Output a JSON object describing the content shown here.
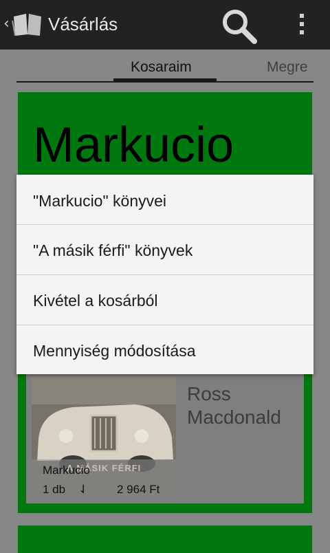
{
  "actionbar": {
    "title": "Vásárlás",
    "up_icon": "chevron-left-icon",
    "logo_icon": "open-book-icon",
    "search_icon": "search-icon",
    "overflow_icon": "more-vertical-icon"
  },
  "tabs": [
    {
      "label": "Kosaraim",
      "active": true
    },
    {
      "label": "Megre",
      "active": false
    }
  ],
  "cart": {
    "title": "Markucio",
    "book": {
      "cover_text": "A MÁSIK FÉRFI",
      "title": "Markucio",
      "quantity": "1 db",
      "price": "2 964 Ft",
      "author": "Ross Macdonald"
    }
  },
  "context_menu": {
    "items": [
      "\"Markucio\" könyvei",
      "\"A másik férfi\" könyvek",
      "Kivétel a kosárból",
      "Mennyiség módosítása"
    ]
  },
  "colors": {
    "actionbar_bg": "#222222",
    "card_green": "#00780f",
    "dim_background": "#878787",
    "menu_bg": "#f4f4f4"
  }
}
